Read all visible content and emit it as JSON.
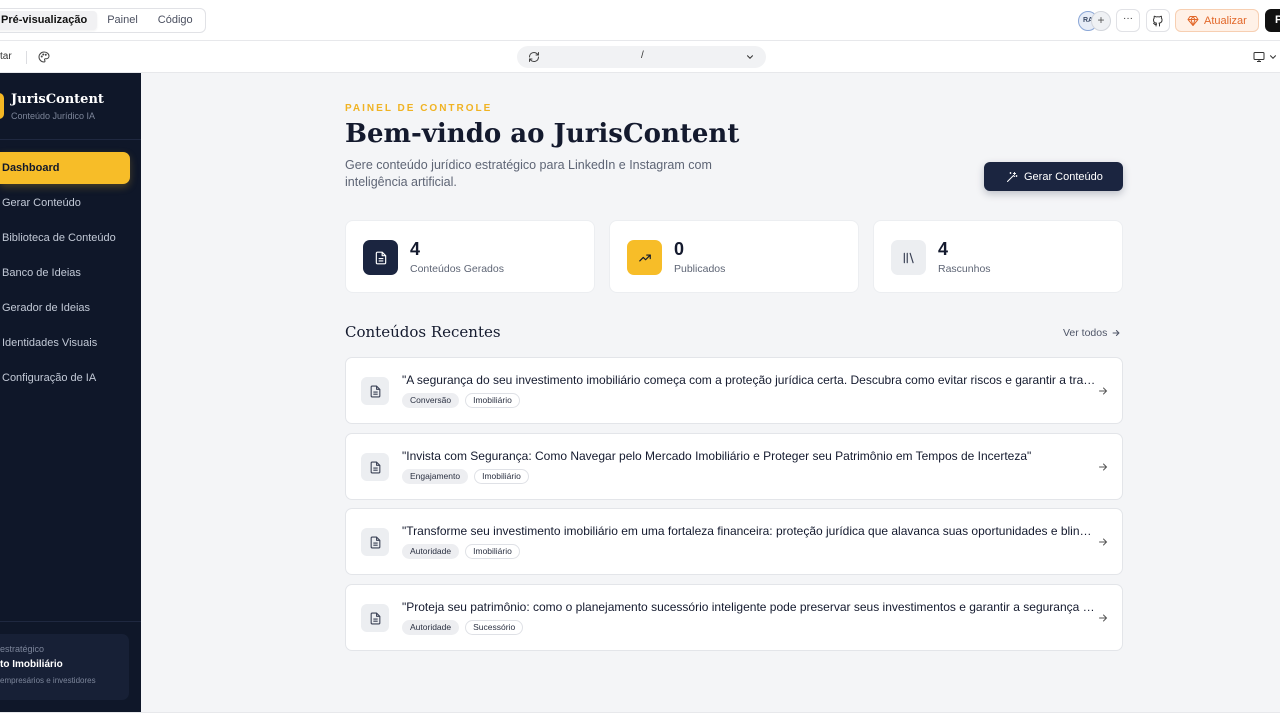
{
  "editor": {
    "tabs": [
      {
        "label": "Pré-visualização"
      },
      {
        "label": "Painel"
      },
      {
        "label": "Código"
      }
    ],
    "avatar_initials": "RA",
    "add_symbol": "+",
    "more_symbol": "···",
    "upgrade_label": "Atualizar",
    "publish_label": "P",
    "left_label": "tar",
    "url_path": "/"
  },
  "sidebar": {
    "brand": "JurisContent",
    "brand_sub": "Conteúdo Jurídico IA",
    "items": [
      {
        "label": "Dashboard"
      },
      {
        "label": "Gerar Conteúdo"
      },
      {
        "label": "Biblioteca de Conteúdo"
      },
      {
        "label": "Banco de Ideias"
      },
      {
        "label": "Gerador de Ideias"
      },
      {
        "label": "Identidades Visuais"
      },
      {
        "label": "Configuração de IA"
      }
    ],
    "card": {
      "line1": "estratégico",
      "line2": "to Imobiliário",
      "line3": "empresários e investidores"
    }
  },
  "main": {
    "kicker": "PAINEL DE CONTROLE",
    "title": "Bem-vindo ao JurisContent",
    "subtitle": "Gere conteúdo jurídico estratégico para LinkedIn e Instagram com inteligência artificial.",
    "cta_label": "Gerar Conteúdo",
    "stats": [
      {
        "value": "4",
        "label": "Conteúdos Gerados"
      },
      {
        "value": "0",
        "label": "Publicados"
      },
      {
        "value": "4",
        "label": "Rascunhos"
      }
    ],
    "recent_title": "Conteúdos Recentes",
    "see_all": "Ver todos",
    "recent": [
      {
        "text": "\"A segurança do seu investimento imobiliário começa com a proteção jurídica certa. Descubra como evitar riscos e garantir a tranquilidade do seu patrimônio.\"",
        "tag1": "Conversão",
        "tag2": "Imobiliário"
      },
      {
        "text": "\"Invista com Segurança: Como Navegar pelo Mercado Imobiliário e Proteger seu Patrimônio em Tempos de Incerteza\"",
        "tag1": "Engajamento",
        "tag2": "Imobiliário"
      },
      {
        "text": "\"Transforme seu investimento imobiliário em uma fortaleza financeira: proteção jurídica que alavanca suas oportunidades e blinda seu patrimônio.\"",
        "tag1": "Autoridade",
        "tag2": "Imobiliário"
      },
      {
        "text": "\"Proteja seu patrimônio: como o planejamento sucessório inteligente pode preservar seus investimentos e garantir a segurança da sua família.\"",
        "tag1": "Autoridade",
        "tag2": "Sucessório"
      }
    ]
  },
  "colors": {
    "sidebar_bg": "#0f1729",
    "accent": "#f7bd28",
    "primary": "#1b2540",
    "upgrade": "#e2682a"
  }
}
